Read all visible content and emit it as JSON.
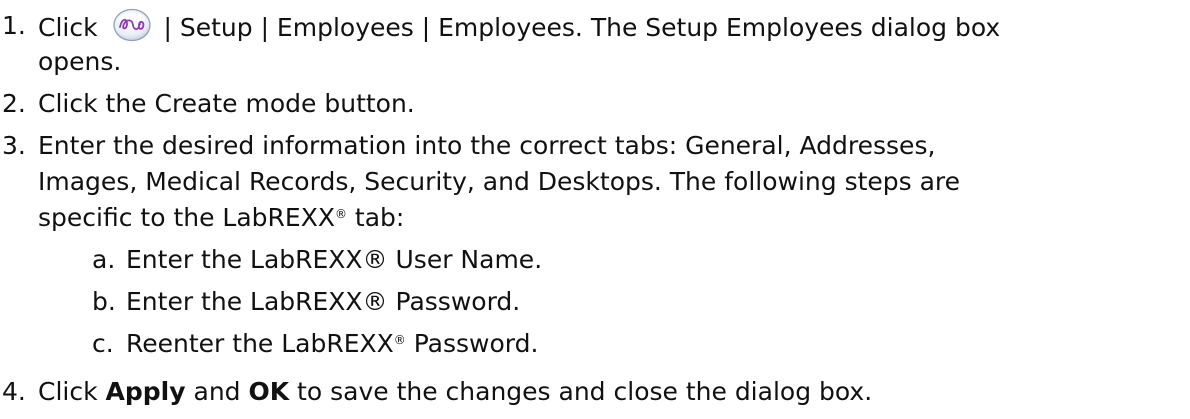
{
  "steps": [
    {
      "num": "1.",
      "pre": "Click",
      "icon": "app-logo-icon",
      "post": "| Setup | Employees | Employees. The Setup Employees dialog box",
      "cont": "opens."
    },
    {
      "num": "2.",
      "text": "Click the Create mode button."
    },
    {
      "num": "3.",
      "line1": "Enter the desired information into the correct tabs: General, Addresses,",
      "line2": "Images, Medical Records, Security, and Desktops. The following steps are",
      "line3_pre": "specific to the LabREXX",
      "line3_reg": "®",
      "line3_post": " tab:"
    },
    {
      "num": "4.",
      "pre": "Click ",
      "b1": "Apply",
      "mid": " and ",
      "b2": "OK",
      "post": " to save the changes and close the dialog box."
    }
  ],
  "substeps": [
    {
      "num": "a.",
      "text": "Enter the LabREXX® User Name."
    },
    {
      "num": "b.",
      "text": "Enter the LabREXX® Password."
    },
    {
      "num": "c.",
      "pre": "Reenter the LabREXX",
      "reg": "®",
      "post": " Password."
    }
  ]
}
